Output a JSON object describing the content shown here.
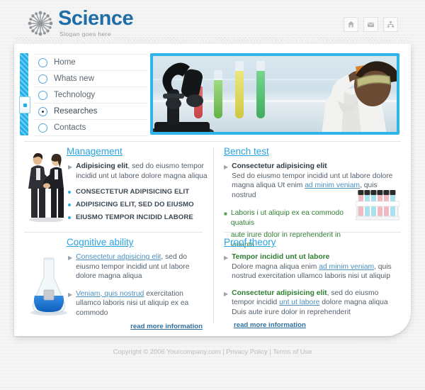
{
  "header": {
    "logo_title": "Science",
    "slogan": "Slogan goes here",
    "logo_icon": "snowflake-burst-logo",
    "icons": [
      {
        "name": "home-icon",
        "label": "Home"
      },
      {
        "name": "mail-icon",
        "label": "Contact"
      },
      {
        "name": "sitemap-icon",
        "label": "Sitemap"
      }
    ]
  },
  "nav": {
    "items": [
      {
        "label": "Home",
        "selected": false
      },
      {
        "label": "Whats new",
        "selected": false
      },
      {
        "label": "Technology",
        "selected": false
      },
      {
        "label": "Researches",
        "selected": true
      },
      {
        "label": "Contacts",
        "selected": false
      }
    ]
  },
  "banner": {
    "alt": "Laboratory scene with microscope, colored test tubes and a scientist holding an orange flask",
    "border_color": "#2fb4ea",
    "tube_colors": [
      "#d94b4b",
      "#7fcf5a",
      "#e0d84a",
      "#55c06a"
    ]
  },
  "sections": {
    "management": {
      "title": "Management",
      "figure": "business-handshake-photo",
      "intro_bold": "Adipisicing elit",
      "intro_rest": ", sed do eiusmo tempor incidid unt ut labore dolore magna aliqua",
      "list": [
        "CONSECTETUR ADIPISICING ELIT",
        "ADIPISICING ELIT, SED DO EIUSMO",
        "EIUSMO TEMPOR INCIDID LABORE"
      ]
    },
    "bench_test": {
      "title": "Bench test",
      "figure": "test-tube-rack-photo",
      "item1_bold": "Consectetur adipisicing elit",
      "item1_text_a": "Sed do eiusmo tempor incidid unt ut labore dolore magna aliqua Ut enim ",
      "item1_link": "ad minim veniam",
      "item1_text_b": ", quis nostrud",
      "item2_line1": "Laboris i ut aliquip ex ea commodo quatuis",
      "item2_line2": "aute irure dolor in reprehenderit in volupta"
    },
    "cognitive_ability": {
      "title": "Cognitive ability",
      "figure": "blue-flask-photo",
      "item1_link": "Consectetur adpisicing elit",
      "item1_text": ", sed do eiusmo tempor incidid unt ut labore dolore magna aliqua",
      "item2_link": "Veniam, quis nostrud",
      "item2_text": " exercitation ullamco laboris nisi ut aliquip ex ea commodo",
      "read_more": "read more information"
    },
    "proof_theory": {
      "title": "Proof theory",
      "item1_bold": "Tempor incidid unt ut labore",
      "item1_text_a": "Dolore magna aliqua enim ",
      "item1_link": "ad minim veniam",
      "item1_text_b": ", quis nostrud exercitation ullamco laboris nisi ut aliquip",
      "item2_bold": "Consectetur adipisicing elit",
      "item2_text_a": ", sed do eiusmo tempor incidid ",
      "item2_link": "unt ut labore",
      "item2_text_b": " dolore magna aliqua Duis aute irure dolor in reprehenderit",
      "read_more": "read more information"
    }
  },
  "footer": {
    "copyright": "Copyright © 2006 Yourcompany.com",
    "sep1": "|",
    "privacy": "Privacy Policy",
    "sep2": "|",
    "terms": "Terms of Use"
  }
}
